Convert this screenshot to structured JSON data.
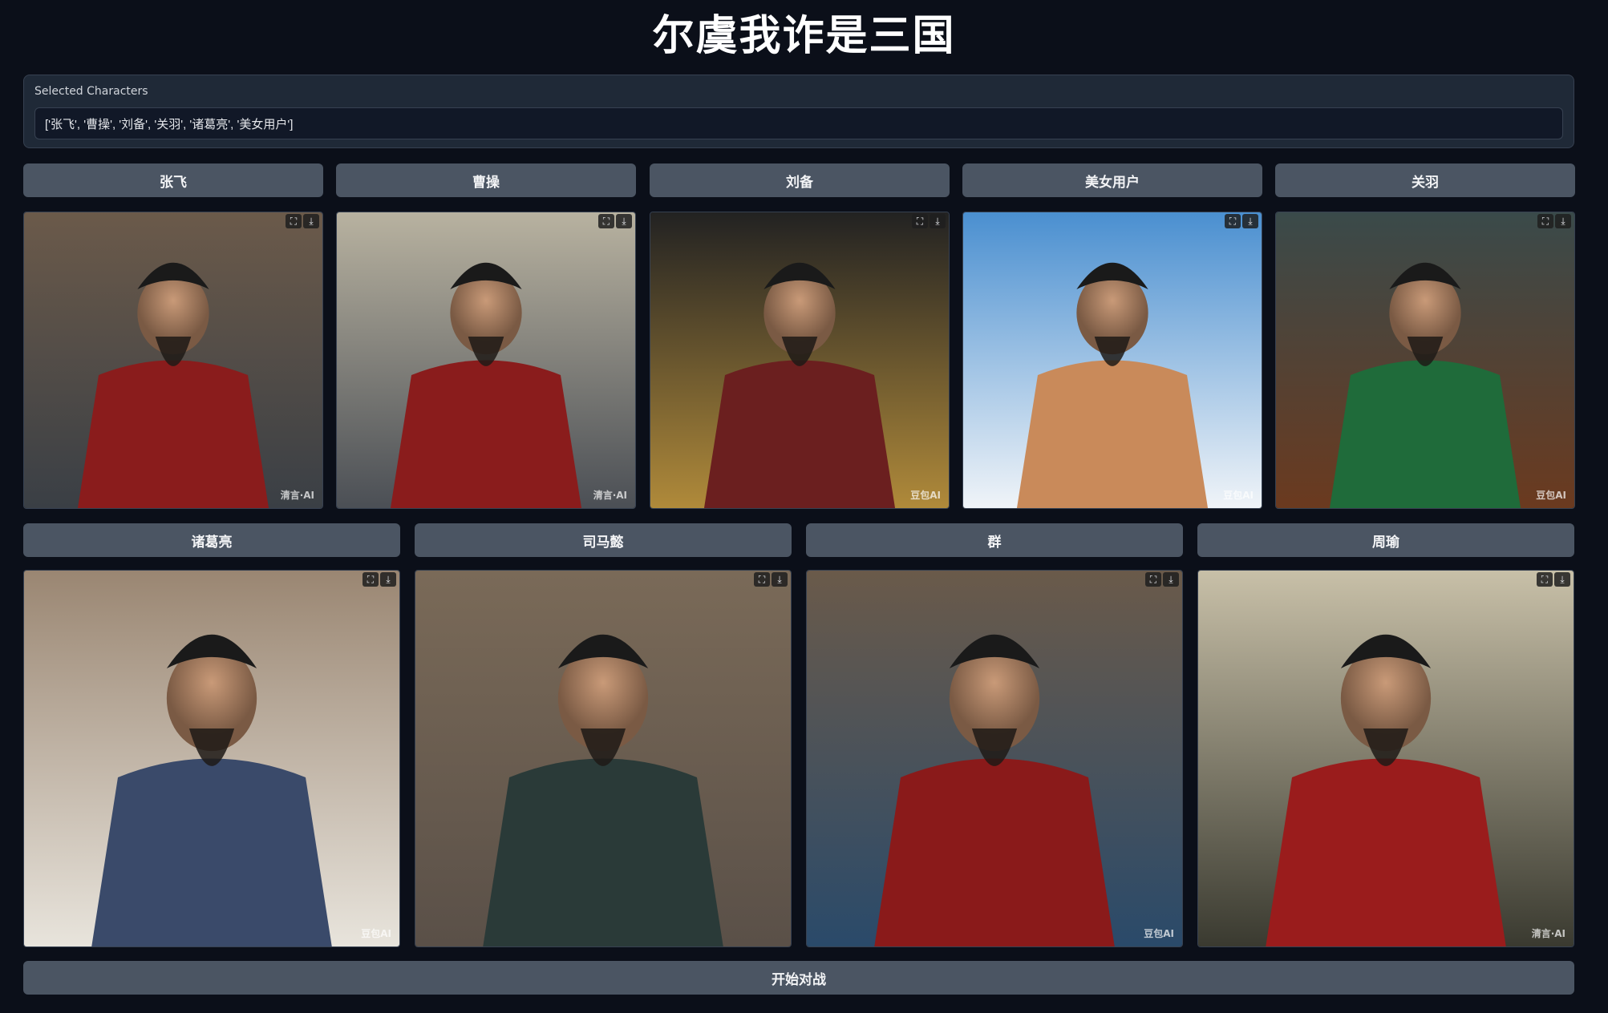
{
  "page": {
    "title": "尔虞我诈是三国"
  },
  "selected": {
    "label": "Selected Characters",
    "value": "['张飞', '曹操', '刘备', '关羽', '诸葛亮', '美女用户']"
  },
  "row1": [
    {
      "label": "张飞",
      "watermark": "清言·AI",
      "colors": [
        "#6b5a4a",
        "#8a1c1c",
        "#3a3f45"
      ]
    },
    {
      "label": "曹操",
      "watermark": "清言·AI",
      "colors": [
        "#b8b2a0",
        "#8a1c1c",
        "#4b4f55"
      ]
    },
    {
      "label": "刘备",
      "watermark": "豆包AI",
      "colors": [
        "#222222",
        "#6b1f1f",
        "#b08a3a"
      ]
    },
    {
      "label": "美女用户",
      "watermark": "豆包AI",
      "colors": [
        "#4a8fd0",
        "#c98a5a",
        "#f0f4f8"
      ]
    },
    {
      "label": "关羽",
      "watermark": "豆包AI",
      "colors": [
        "#3a4a4a",
        "#1f6b3a",
        "#6b3a1f"
      ]
    }
  ],
  "row2": [
    {
      "label": "诸葛亮",
      "watermark": "豆包AI",
      "colors": [
        "#9a8672",
        "#3a4a6a",
        "#e8e4dc"
      ]
    },
    {
      "label": "司马懿",
      "watermark": "",
      "colors": [
        "#7a6a58",
        "#2a3a38",
        "#5a5048"
      ]
    },
    {
      "label": "群",
      "watermark": "豆包AI",
      "colors": [
        "#6a5a4a",
        "#8a1a1a",
        "#2a4a6a"
      ]
    },
    {
      "label": "周瑜",
      "watermark": "清言·AI",
      "colors": [
        "#c8c0a8",
        "#9a1c1c",
        "#3a3a30"
      ]
    }
  ],
  "tools": {
    "fullscreen_icon": "⛶",
    "download_icon": "⤓"
  },
  "battle_button": "开始对战"
}
